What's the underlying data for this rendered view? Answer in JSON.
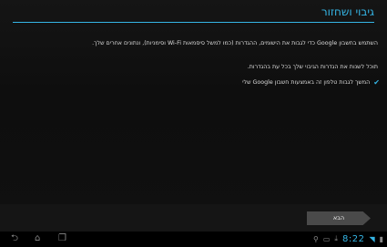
{
  "title": "גיבוי ושחזור",
  "paragraph1": "השתמש בחשבון Google כדי לגבות את הישומים, ההגדרות (כמו למשל סיסמאות Wi-Fi וסימניות), ונתונים אחרים שלך.",
  "paragraph2": "תוכל לשנות את הגדרות הגיבוי שלך בכל עת בהגדרות.",
  "checkbox_label": "המשך לגבות טלפון זה באמצעות חשבון Google שלי",
  "checkbox_checked": true,
  "next_button": "הבא",
  "status_bar": {
    "time": "8:22",
    "icons": [
      "usb-icon",
      "screenshot-icon",
      "download-icon",
      "wifi-icon",
      "battery-icon"
    ]
  },
  "nav_icons": [
    "back-icon",
    "home-icon",
    "recent-apps-icon"
  ],
  "colors": {
    "accent": "#35b5e5",
    "background": "#111111",
    "button": "#4a4a4a"
  }
}
